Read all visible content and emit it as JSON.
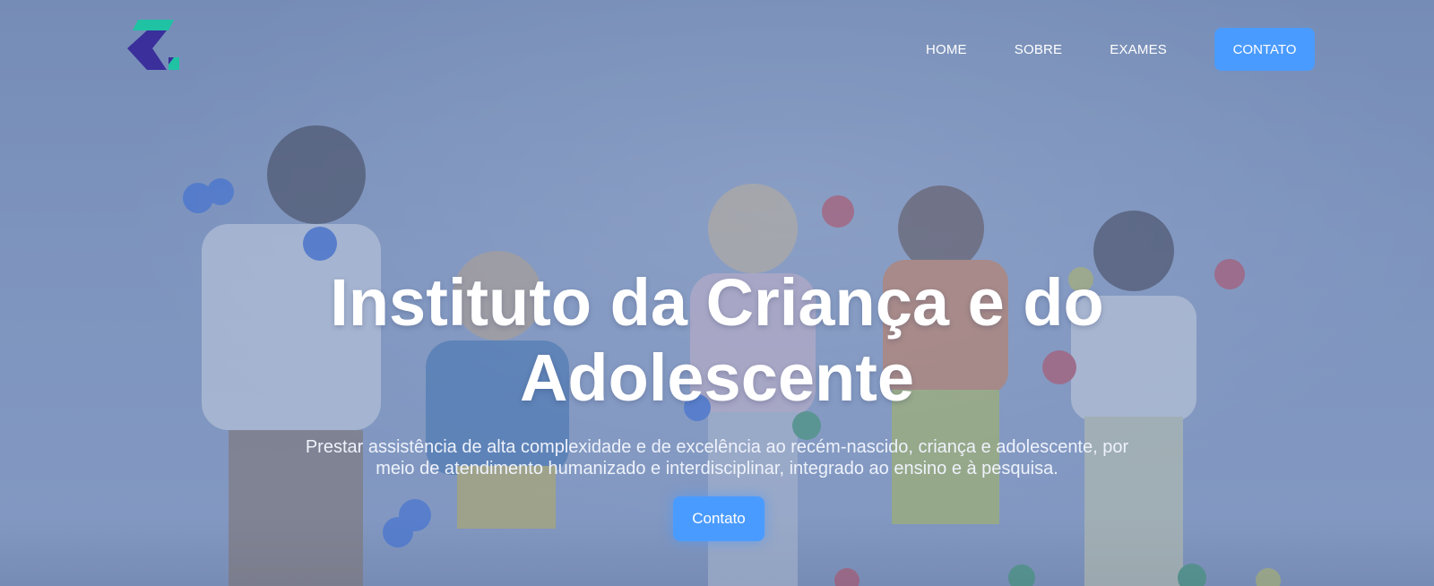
{
  "brand": {
    "logo_icon": "institute-c-logo",
    "colors": {
      "logo_teal": "#1fc3a3",
      "logo_navy": "#3a2f9b",
      "accent": "#4a9bff"
    }
  },
  "nav": {
    "items": [
      {
        "label": "HOME"
      },
      {
        "label": "SOBRE"
      },
      {
        "label": "EXAMES"
      }
    ],
    "cta_label": "CONTATO"
  },
  "hero": {
    "title_lines": [
      "Instituto da Criança e do",
      "Adolescente"
    ],
    "subtitle_lines": [
      "Prestar assistência de alta complexidade e de excelência ao recém-nascido, criança e adolescente, por",
      "meio de atendimento humanizado e interdisciplinar, integrado ao ensino e à pesquisa."
    ],
    "cta_label": "Contato",
    "background_image": "children-playing-with-balls-photo"
  }
}
